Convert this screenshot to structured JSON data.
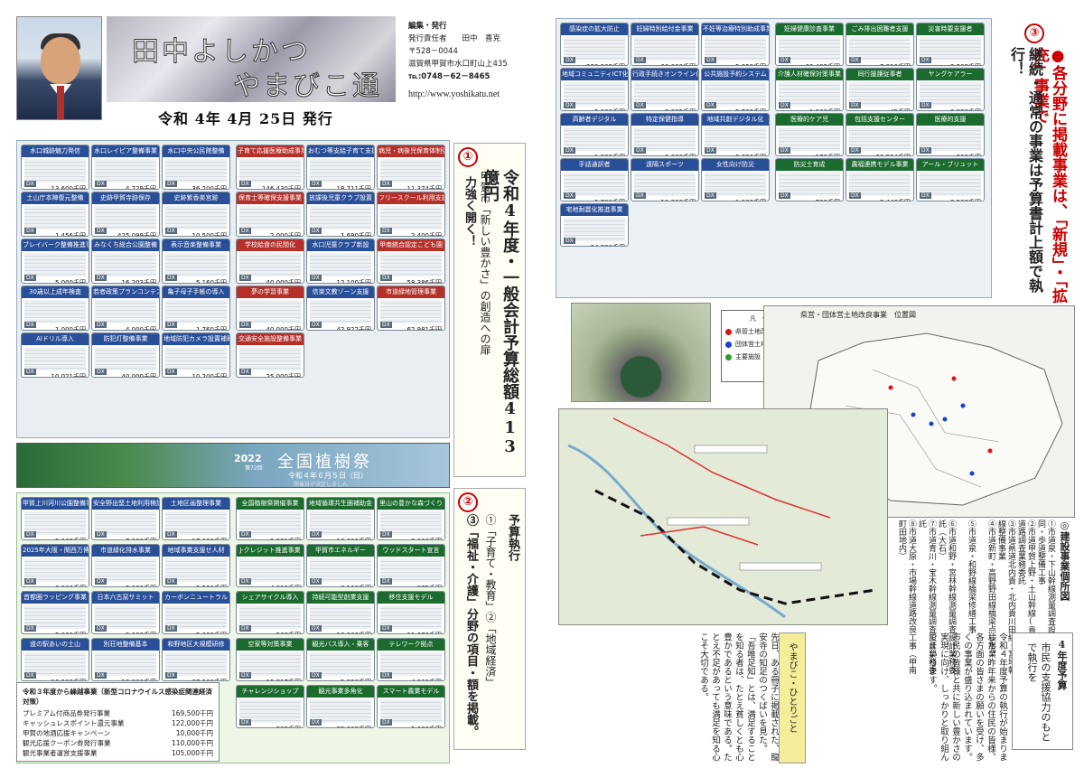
{
  "header": {
    "title_line1": "田中よしかつ",
    "title_line2": "やまびこ通信",
    "issue_date": "令和 4年 4月 25日 発行",
    "publisher": {
      "label": "編集・発行",
      "responsible": "発行責任者　　田中　喜克",
      "postal": "〒528－0044",
      "address": "滋賀県甲賀市水口町山上435",
      "tel": "℡:0748－62－8465",
      "url": "http://www.yoshikatu.net"
    }
  },
  "section1": {
    "number": "①",
    "headline": "令和4年度・一般会計予算総額413億円",
    "sub1": "甲賀市「新しい豊かさ」の創造への扉",
    "sub2": "力強く開く！"
  },
  "section2": {
    "number": "②",
    "line1": "予算執行",
    "line2": "①「子育て・教育」②「地域経済」",
    "line3": "③「福祉・介護」分野の項目・額を掲載。"
  },
  "section3": {
    "number": "③",
    "line1": "●各分野に掲載事業は、「新規」・「拡充」事業で",
    "line2": "継続・通常の事業は予算書計上額で執行！"
  },
  "left_programs": [
    {
      "name": "水口城跡魅力発信",
      "amount": "13,600千円"
    },
    {
      "name": "水口レイピア整備事業",
      "amount": "4,729千円"
    },
    {
      "name": "水口中央公民館整備",
      "amount": "36,200千円"
    },
    {
      "name": "子育て応援医療助成事業",
      "amount": "146,430千円"
    },
    {
      "name": "おむつ等支給子育て支援",
      "amount": "18,711千円"
    },
    {
      "name": "病児・病後児保育体制強化",
      "amount": "11,374千円"
    },
    {
      "name": "土山庁本陣復元整備",
      "amount": "1,456千円"
    },
    {
      "name": "史跡甲賀寺跡保存",
      "amount": "425,099千円"
    },
    {
      "name": "史跡紫香楽宮跡",
      "amount": "10,500千円"
    },
    {
      "name": "保育士等確保支援事業",
      "amount": "2,000千円"
    },
    {
      "name": "放課後児童クラブ設置",
      "amount": "1,690千円"
    },
    {
      "name": "フリースクール利用支援",
      "amount": "2,400千円"
    },
    {
      "name": "ブレイバーク整備推進事業",
      "amount": "5,000千円"
    },
    {
      "name": "みなくち総合公園整備",
      "amount": "16,203千円"
    },
    {
      "name": "表示音楽整備事業",
      "amount": "5,160千円"
    },
    {
      "name": "学校給食の民間化",
      "amount": "40,000千円"
    },
    {
      "name": "水口児童クラブ新設",
      "amount": "12,100千円"
    },
    {
      "name": "甲南統合認定こども園",
      "amount": "58,386千円"
    },
    {
      "name": "30歳以上成年検査",
      "amount": "1,000千円"
    },
    {
      "name": "若者政策プランコンテスト",
      "amount": "4,000千円"
    },
    {
      "name": "亀子母子手帳の導入",
      "amount": "1,760千円"
    },
    {
      "name": "夢の学習事業",
      "amount": "40,000千円"
    },
    {
      "name": "信楽文教ゾーン支援",
      "amount": "42,922千円"
    },
    {
      "name": "市道緑地管理事業",
      "amount": "62,981千円"
    },
    {
      "name": "AIドリル導入",
      "amount": "10,021千円"
    },
    {
      "name": "防犯灯整備事業",
      "amount": "40,000千円"
    },
    {
      "name": "地域防犯カメラ設置補助",
      "amount": "10,200千円"
    },
    {
      "name": "交通安全施設整備事業",
      "amount": "25,000千円"
    }
  ],
  "festival": {
    "year": "2022",
    "sub": "第72回",
    "name": "全国植樹祭",
    "date": "令和４年６月５日（日）",
    "note": "開催日が決定しました"
  },
  "green_programs": [
    {
      "name": "甲賀上川河川公園整備事業",
      "amount": "5,000千円"
    },
    {
      "name": "安全野出堅土地利用検討",
      "amount": "7,000千円"
    },
    {
      "name": "土地区画整理事業",
      "amount": "17,000千円"
    },
    {
      "name": "全国植樹祭開催事業",
      "amount": "9,931千円"
    },
    {
      "name": "地域循環共生圏補助金",
      "amount": "10,000千円"
    },
    {
      "name": "里山の豊かな森づくり",
      "amount": "3,000千円"
    },
    {
      "name": "2025年大阪・関西万博",
      "amount": "8,000千円"
    },
    {
      "name": "市道緑化排水事業",
      "amount": "2,000千円"
    },
    {
      "name": "地域事業支援せ人材",
      "amount": "2,500千円"
    },
    {
      "name": "J-クレジット推進事業",
      "amount": "4,000千円"
    },
    {
      "name": "甲賀市エネルギー",
      "amount": "3,100千円"
    },
    {
      "name": "ウッドスタート宣言",
      "amount": "875千円"
    },
    {
      "name": "首都圏ラッピング事業",
      "amount": "5,000千円"
    },
    {
      "name": "日本六古窯サミット",
      "amount": "2,000千円"
    },
    {
      "name": "カーボンニュートラル",
      "amount": "2,000千円"
    },
    {
      "name": "シェアサイクル導入",
      "amount": "560千円"
    },
    {
      "name": "持続可能型創業支援",
      "amount": "10,900千円"
    },
    {
      "name": "移住支援モデル",
      "amount": "11,676千円"
    },
    {
      "name": "道の駅あいの土山",
      "amount": "10,500千円"
    },
    {
      "name": "別荘地整備基本",
      "amount": "10,000千円"
    },
    {
      "name": "和野地区大規模研修",
      "amount": "87,300千円"
    },
    {
      "name": "空家等対策事業",
      "amount": "15,617千円"
    },
    {
      "name": "観光バス導入・乗客",
      "amount": "2,000千円"
    },
    {
      "name": "テレワーク拠点",
      "amount": "4,000千円"
    },
    {
      "name": "チャレンジショップ",
      "amount": "909千円"
    },
    {
      "name": "観光事業多角化",
      "amount": "35,000千円"
    },
    {
      "name": "スマート農業モデル",
      "amount": "5,000千円"
    }
  ],
  "covid": {
    "title": "令和３年度から繰越事業（新型コロナウイルス感染症関連経済対策）",
    "items": [
      {
        "name": "プレミアム付商品券発行事業",
        "amount": "169,500千円"
      },
      {
        "name": "キャッシュレスポイント還元事業",
        "amount": "122,000千円"
      },
      {
        "name": "甲賀の地酒応援キャンペーン",
        "amount": "10,000千円"
      },
      {
        "name": "観光応援クーポン券発行事業",
        "amount": "110,000千円"
      },
      {
        "name": "観光事業者運営支援事業",
        "amount": "105,000千円"
      }
    ]
  },
  "right_programs": [
    {
      "name": "感染症の拡大防止",
      "amount": "239,903千円"
    },
    {
      "name": "妊婦特別給付金事業",
      "amount": "60,000千円"
    },
    {
      "name": "不妊等治療特別助成事業",
      "amount": "5,050千円"
    },
    {
      "name": "妊婦健康診査事業",
      "amount": "69,492千円"
    },
    {
      "name": "ごみ排出困難者支援",
      "amount": "7,316千円"
    },
    {
      "name": "災害時要支援者",
      "amount": "2,209千円"
    },
    {
      "name": "地域コミュニティICT化推進",
      "amount": "5,000千円"
    },
    {
      "name": "行政手続きオンライン化",
      "amount": "3,895千円"
    },
    {
      "name": "公共施設予約システム",
      "amount": "2,769千円"
    },
    {
      "name": "介護人材確保対策事業",
      "amount": "1,200千円"
    },
    {
      "name": "同行援護従事者",
      "amount": "45千円"
    },
    {
      "name": "ヤングケアラー",
      "amount": "3,333千円"
    },
    {
      "name": "高齢者デジタル",
      "amount": "1,300千円"
    },
    {
      "name": "特定保健指導",
      "amount": "1,000千円"
    },
    {
      "name": "地域共創デジタル化",
      "amount": "3,630千円"
    },
    {
      "name": "医療的ケア児",
      "amount": "179千円"
    },
    {
      "name": "包括支援センター",
      "amount": "28,294千円"
    },
    {
      "name": "医療的支援",
      "amount": "300千円"
    },
    {
      "name": "手話通訳者",
      "amount": "9,790千円"
    },
    {
      "name": "遠隔スポーツ",
      "amount": "11,800千円"
    },
    {
      "name": "女性向け防災",
      "amount": "1,000千円"
    },
    {
      "name": "防災士育成",
      "amount": "730千円"
    },
    {
      "name": "農福連携モデル事業",
      "amount": "2,440千円"
    },
    {
      "name": "アール・ブリュット",
      "amount": "3,500千円"
    },
    {
      "name": "宅地耐震化推進事業",
      "amount": "34,000千円"
    }
  ],
  "map_legend": {
    "title": "凡　例",
    "items": [
      {
        "label": "県管土地改良事業",
        "color": "#d11"
      },
      {
        "label": "団体営土地改良事業",
        "color": "#1a3fd1"
      },
      {
        "label": "主要施設",
        "color": "#2a9a2a"
      }
    ]
  },
  "map_title": "県営・団体営土地改良事業　位置図",
  "construction": {
    "heading": "◎建設事業個所図",
    "items": [
      "①市道泉・下山幹線測量調査設計業務委託　同・歩道整備工事",
      "②市道甲賀上野・土山幹線(貴生川)工区道路調査業務委託",
      "③市道県道北内貴・北内貴川田線・宮地幹線整備事業",
      "④市道新町・高野野田線橋梁点検事業",
      "⑤市道泉・和野線橋梁修繕工事",
      "⑥市道和野・宮林幹線測量調査設計業務委託（大石）",
      "⑦市道青川・宝木幹線測量調査設計業務委託",
      "⑧市道大原・市場幹線道路改良工事（甲南町田地内）"
    ]
  },
  "diary": {
    "box_label": "やまびこ・ひとりごと",
    "text": "先日、ある冊子に掲載された、龍安寺の知足のつくばいを見た。「吾唯足知」とは、満足することを知る者は、たとえ貧しくとも心豊かであるという意味である。たとえ不足があっても満足を知る心こそ大切である。"
  },
  "budget": {
    "box_title": "4年度予算",
    "box_sub": "市民の支援協力のもとで執行を",
    "text": "令和４年度予算の執行が始まりました。昨年来からの住民の皆様、各方面の皆さまの願いを受け、多くの事業が盛り込まれています。市民の皆様と共に新しい豊かさの実現に向け、しっかりと取り組んでまいります。"
  }
}
